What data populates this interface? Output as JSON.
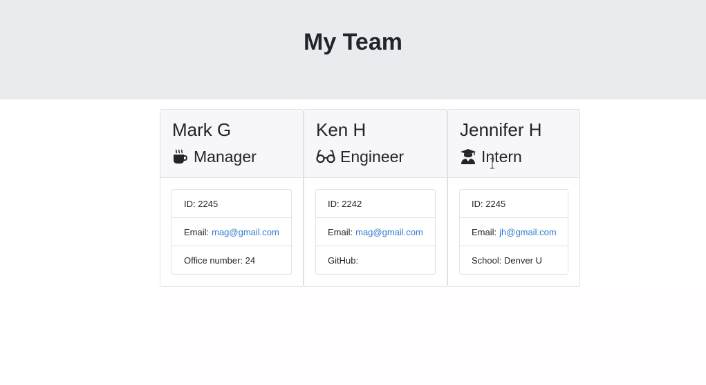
{
  "header": {
    "title": "My Team"
  },
  "members": [
    {
      "name": "Mark G",
      "role": "Manager",
      "icon": "coffee-icon",
      "id_label": "ID:",
      "id": "2245",
      "email_label": "Email:",
      "email": "mag@gmail.com",
      "extra_label": "Office number:",
      "extra_value": "24"
    },
    {
      "name": "Ken H",
      "role": "Engineer",
      "icon": "glasses-icon",
      "id_label": "ID:",
      "id": "2242",
      "email_label": "Email:",
      "email": "mag@gmail.com",
      "extra_label": "GitHub:",
      "extra_value": ""
    },
    {
      "name": "Jennifer H",
      "role": "Intern",
      "icon": "graduate-icon",
      "id_label": "ID:",
      "id": "2245",
      "email_label": "Email:",
      "email": "jh@gmail.com",
      "extra_label": "School:",
      "extra_value": "Denver U"
    }
  ],
  "colors": {
    "header_bg": "#e9ecef",
    "card_header_bg": "#f7f6f8",
    "link": "#2f7dd1",
    "border": "#dee2e6"
  }
}
